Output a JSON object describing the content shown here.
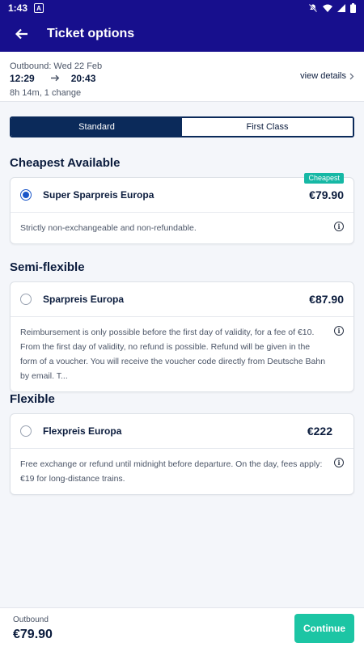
{
  "status": {
    "time": "1:43",
    "app_glyph": "A"
  },
  "appbar": {
    "title": "Ticket options"
  },
  "journey": {
    "outbound_label": "Outbound: Wed 22 Feb",
    "depart": "12:29",
    "arrive": "20:43",
    "meta": "8h 14m, 1 change",
    "view_details": "view details"
  },
  "tabs": [
    {
      "label": "Standard",
      "active": true
    },
    {
      "label": "First Class",
      "active": false
    }
  ],
  "sections": [
    {
      "title": "Cheapest Available",
      "fare": {
        "name": "Super Sparpreis Europa",
        "price": "€79.90",
        "badge": "Cheapest",
        "selected": true
      },
      "description": "Strictly non-exchangeable and non-refundable."
    },
    {
      "title": "Semi-flexible",
      "fare": {
        "name": "Sparpreis Europa",
        "price": "€87.90",
        "selected": false
      },
      "description": "Reimbursement is only possible before the first day of validity, for a fee of €10. From the first day of validity, no refund is possible. Refund will be given in the form of a voucher. You will receive the voucher code directly from Deutsche Bahn by email. T..."
    },
    {
      "title": "Flexible",
      "fare": {
        "name": "Flexpreis Europa",
        "price": "€222",
        "selected": false
      },
      "description": "Free exchange or refund until midnight before departure. On the day, fees apply: €19 for long-distance trains."
    }
  ],
  "footer": {
    "label": "Outbound",
    "total": "€79.90",
    "continue_label": "Continue"
  },
  "colors": {
    "brand": "#170f8d",
    "navy": "#0b2a5a",
    "accent": "#1cc5a4",
    "radio": "#1a56c8"
  }
}
